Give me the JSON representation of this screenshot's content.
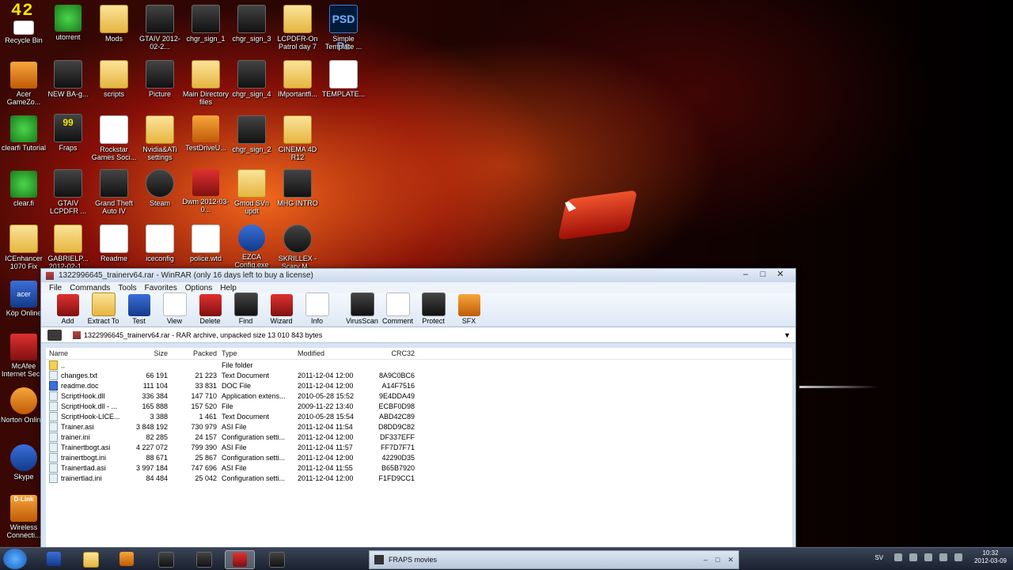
{
  "overlay": {
    "fps": "42"
  },
  "desktop_icons": [
    {
      "label": "Recycle Bin"
    },
    {
      "label": "utorrent"
    },
    {
      "label": "Mods"
    },
    {
      "label": "GTAIV 2012-02-2..."
    },
    {
      "label": "chgr_sign_1"
    },
    {
      "label": "chgr_sign_3"
    },
    {
      "label": "LCPDFR-On Patrol day 7"
    },
    {
      "label": "Simple Template ..."
    },
    {
      "label": "Acer GameZo..."
    },
    {
      "label": "NEW BA-g..."
    },
    {
      "label": "scripts"
    },
    {
      "label": "Picture"
    },
    {
      "label": "Main Directory files"
    },
    {
      "label": "chgr_sign_4"
    },
    {
      "label": "IMportantfi..."
    },
    {
      "label": "TEMPLATE..."
    },
    {
      "label": "clearfi Tutorial"
    },
    {
      "label": "Fraps"
    },
    {
      "label": "Rockstar Games Soci..."
    },
    {
      "label": "Nvidia&ATi settings"
    },
    {
      "label": "TestDriveU..."
    },
    {
      "label": "chgr_sign_2"
    },
    {
      "label": "CINEMA 4D R12"
    },
    {
      "label": "clear.fi"
    },
    {
      "label": "GTAIV LCPDFR ..."
    },
    {
      "label": "Grand Theft Auto IV"
    },
    {
      "label": "Steam"
    },
    {
      "label": "Dwm 2012-03-0..."
    },
    {
      "label": "Gmod SVn updt"
    },
    {
      "label": "MHG INTRO"
    },
    {
      "label": "ICEnhancer 1070 Fix"
    },
    {
      "label": "GABRIELP... 2012-02-1..."
    },
    {
      "label": "Readme"
    },
    {
      "label": "iceconfig"
    },
    {
      "label": "police.wtd"
    },
    {
      "label": "EZCA Config.exe"
    },
    {
      "label": "SKRILLEX - Scary M..."
    },
    {
      "label": "Köp Online"
    },
    {
      "label": "McAfee Internet Sec..."
    },
    {
      "label": "Norton Onlin..."
    },
    {
      "label": "Skype"
    },
    {
      "label": "Wireless Connecti..."
    }
  ],
  "badges": {
    "fraps_count": "99",
    "ps_text": "PSD Ps",
    "acer": "acer",
    "dlink": "D-Link"
  },
  "winrar": {
    "title": "1322996645_trainerv64.rar - WinRAR (only 16 days left to buy a license)",
    "menu": [
      "File",
      "Commands",
      "Tools",
      "Favorites",
      "Options",
      "Help"
    ],
    "toolbar": [
      "Add",
      "Extract To",
      "Test",
      "View",
      "Delete",
      "Find",
      "Wizard",
      "Info",
      "VirusScan",
      "Comment",
      "Protect",
      "SFX"
    ],
    "address": "1322996645_trainerv64.rar - RAR archive, unpacked size 13 010 843 bytes",
    "columns": {
      "name": "Name",
      "size": "Size",
      "packed": "Packed",
      "type": "Type",
      "modified": "Modified",
      "crc": "CRC32"
    },
    "files": [
      {
        "name": "..",
        "size": "",
        "packed": "",
        "type": "File folder",
        "modified": "",
        "crc": ""
      },
      {
        "name": "changes.txt",
        "size": "66 191",
        "packed": "21 223",
        "type": "Text Document",
        "modified": "2011-12-04 12:00",
        "crc": "8A9C0BC6"
      },
      {
        "name": "readme.doc",
        "size": "111 104",
        "packed": "33 831",
        "type": "DOC File",
        "modified": "2011-12-04 12:00",
        "crc": "A14F7516"
      },
      {
        "name": "ScriptHook.dll",
        "size": "336 384",
        "packed": "147 710",
        "type": "Application extens...",
        "modified": "2010-05-28 15:52",
        "crc": "9E4DDA49"
      },
      {
        "name": "ScriptHook.dll - ...",
        "size": "165 888",
        "packed": "157 520",
        "type": "File",
        "modified": "2009-11-22 13:40",
        "crc": "ECBF0D98"
      },
      {
        "name": "ScriptHook-LICE...",
        "size": "3 388",
        "packed": "1 461",
        "type": "Text Document",
        "modified": "2010-05-28 15:54",
        "crc": "ABD42C89"
      },
      {
        "name": "Trainer.asi",
        "size": "3 848 192",
        "packed": "730 979",
        "type": "ASI File",
        "modified": "2011-12-04 11:54",
        "crc": "D8DD9C82"
      },
      {
        "name": "trainer.ini",
        "size": "82 285",
        "packed": "24 157",
        "type": "Configuration setti...",
        "modified": "2011-12-04 12:00",
        "crc": "DF337EFF"
      },
      {
        "name": "Trainertbogt.asi",
        "size": "4 227 072",
        "packed": "799 390",
        "type": "ASI File",
        "modified": "2011-12-04 11:57",
        "crc": "FF7D7F71"
      },
      {
        "name": "trainertbogt.ini",
        "size": "88 671",
        "packed": "25 867",
        "type": "Configuration setti...",
        "modified": "2011-12-04 12:00",
        "crc": "42290D35"
      },
      {
        "name": "Trainertlad.asi",
        "size": "3 997 184",
        "packed": "747 696",
        "type": "ASI File",
        "modified": "2011-12-04 11:55",
        "crc": "B65B7920"
      },
      {
        "name": "trainertlad.ini",
        "size": "84 484",
        "packed": "25 042",
        "type": "Configuration setti...",
        "modified": "2011-12-04 12:00",
        "crc": "F1FD9CC1"
      }
    ]
  },
  "taskbar": {
    "fraps_window": "FRAPS movies",
    "lang": "SV",
    "time": "10:32",
    "date": "2012-03-09"
  }
}
